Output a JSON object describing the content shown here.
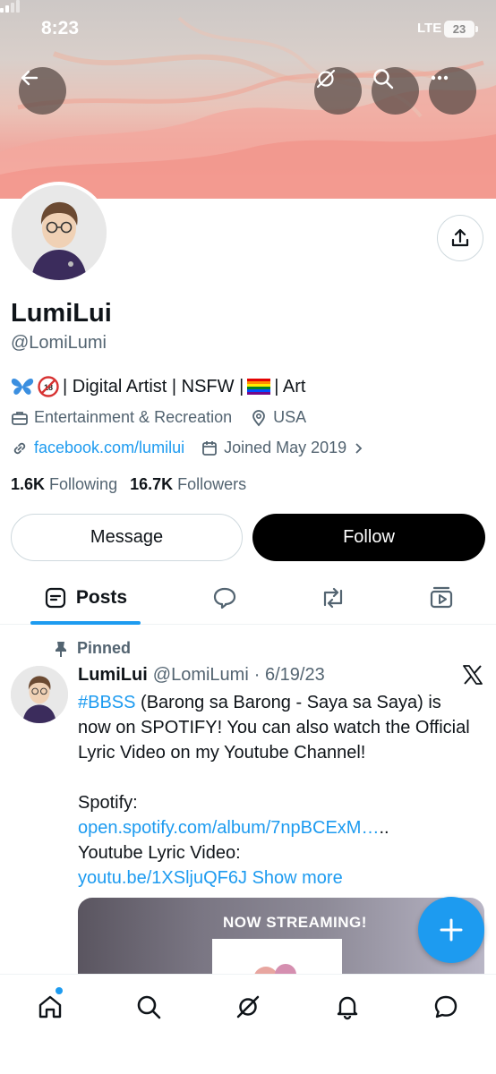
{
  "status_bar": {
    "time": "8:23",
    "network": "LTE",
    "battery": "23"
  },
  "header": {
    "back_icon": "back-arrow-icon",
    "grok_icon": "grok-icon",
    "search_icon": "search-icon",
    "more_icon": "more-icon"
  },
  "profile": {
    "name": "LumiLui",
    "handle": "@LomiLumi",
    "bio_text": "| Digital Artist | NSFW |",
    "bio_end": "| Art",
    "category": "Entertainment & Recreation",
    "location": "USA",
    "website": "facebook.com/lumilui",
    "joined": "Joined May 2019",
    "following_count": "1.6K",
    "following_label": "Following",
    "followers_count": "16.7K",
    "followers_label": "Followers"
  },
  "actions": {
    "message": "Message",
    "follow": "Follow"
  },
  "tabs": {
    "posts": "Posts"
  },
  "post": {
    "pinned_label": "Pinned",
    "author": "LumiLui",
    "author_handle": "@LomiLumi",
    "date": "· 6/19/23",
    "hashtag": "#BBSS",
    "text1": " (Barong sa Barong - Saya sa Saya) is now on SPOTIFY! You can also watch the Official Lyric Video on my Youtube Channel!",
    "spotify_label": "Spotify:",
    "spotify_link": "open.spotify.com/album/7npBCExM…",
    "spotify_tail": "..",
    "youtube_label": "Youtube Lyric Video:",
    "youtube_link": "youtu.be/1XSljuQF6J",
    "show_more": "Show more",
    "image_text": "NOW STREAMING!"
  },
  "colors": {
    "accent": "#1d9bf0",
    "text": "#0f1419",
    "muted": "#536471"
  }
}
